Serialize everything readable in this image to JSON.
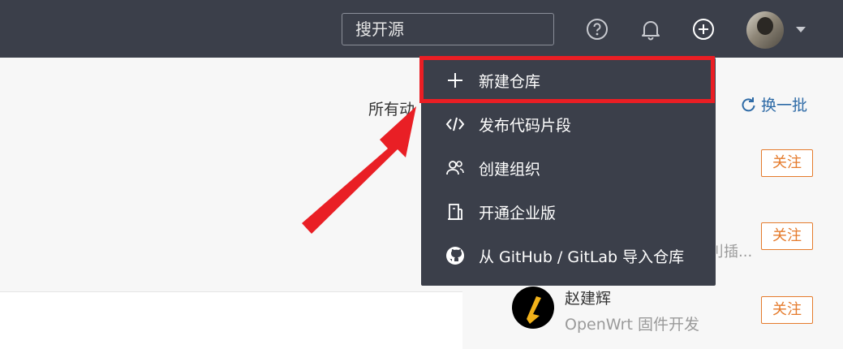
{
  "header": {
    "search_placeholder": "搜开源",
    "icons": [
      "help-icon",
      "bell-icon",
      "plus-circle-icon",
      "avatar",
      "caret-down-icon"
    ]
  },
  "page": {
    "activity_label": "所有动",
    "refresh_label": "换一批",
    "follow_labels": [
      "关注",
      "关注",
      "关注"
    ],
    "snippet": "刂插..."
  },
  "recommended_user": {
    "name": "赵建辉",
    "desc": "OpenWrt 固件开发"
  },
  "dropdown": {
    "items": [
      {
        "label": "新建仓库",
        "icon": "plus-icon"
      },
      {
        "label": "发布代码片段",
        "icon": "code-icon"
      },
      {
        "label": "创建组织",
        "icon": "users-icon"
      },
      {
        "label": "开通企业版",
        "icon": "building-icon"
      },
      {
        "label": "从 GitHub / GitLab 导入仓库",
        "icon": "github-icon"
      }
    ]
  },
  "colors": {
    "topbar": "#3b3f4a",
    "highlight": "#ea1e24",
    "follow": "#e57b2c",
    "link": "#2d6aa6"
  }
}
